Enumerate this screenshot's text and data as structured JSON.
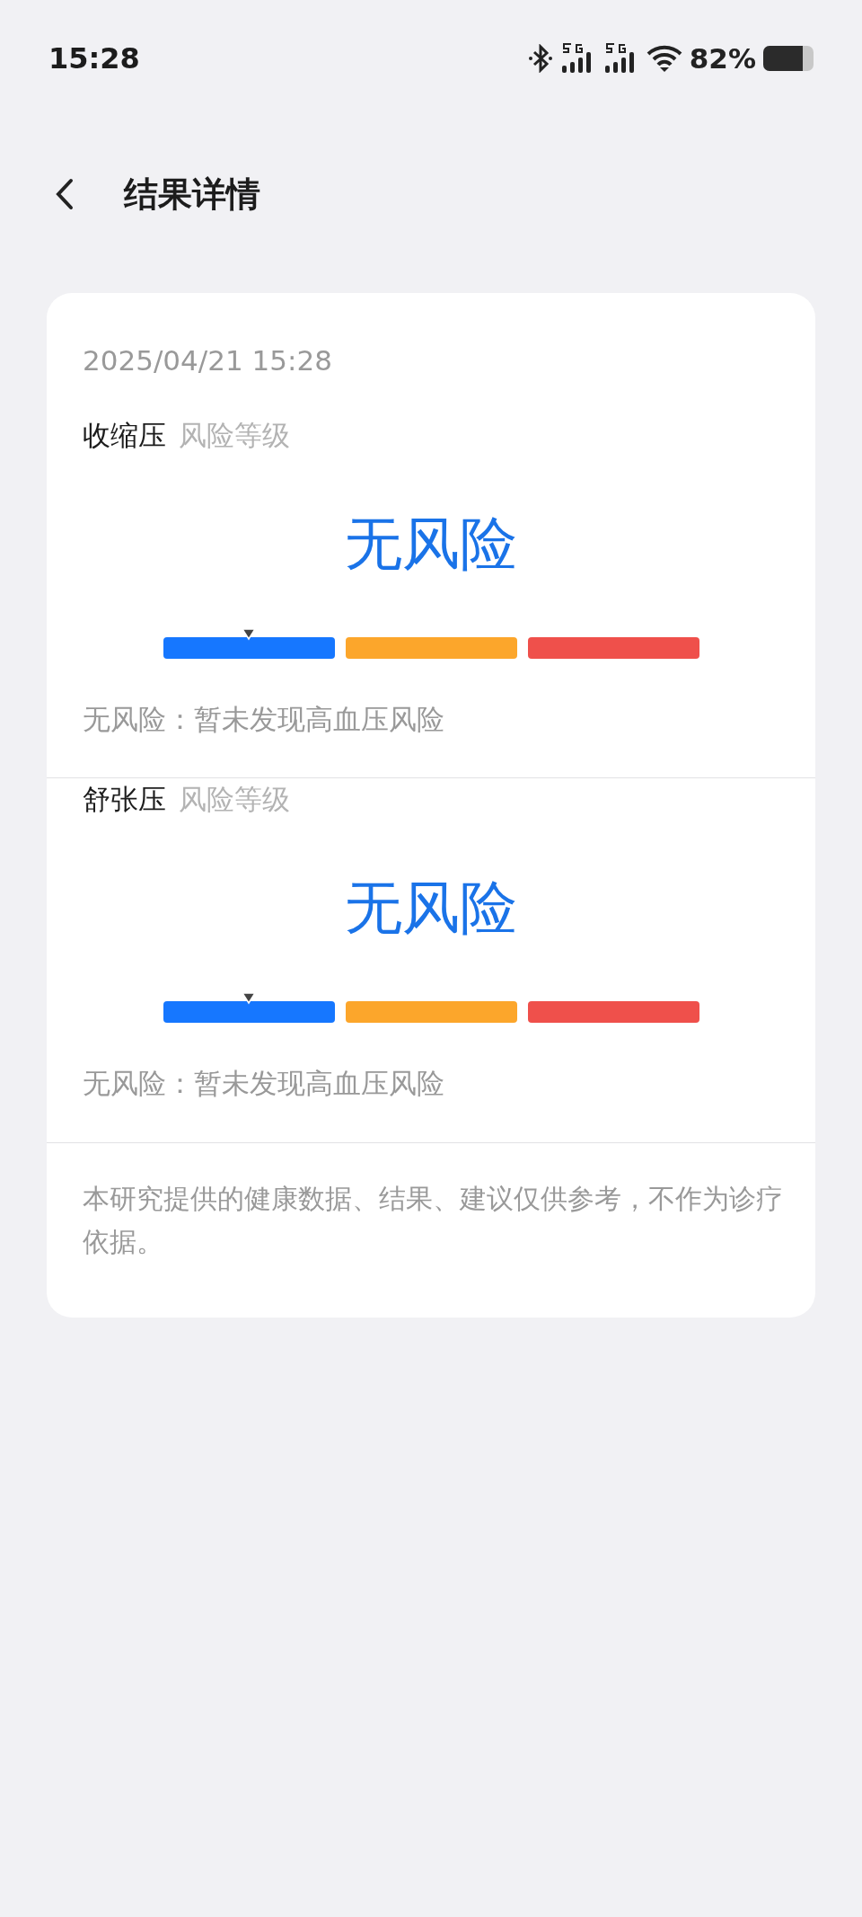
{
  "status_bar": {
    "time": "15:28",
    "battery": "82%"
  },
  "header": {
    "title": "结果详情"
  },
  "card": {
    "date": "2025/04/21 15:28",
    "sections": [
      {
        "label": "收缩压",
        "sublabel": "风险等级",
        "result": "无风险",
        "level": 0.16,
        "description": "无风险：暂未发现高血压风险"
      },
      {
        "label": "舒张压",
        "sublabel": "风险等级",
        "result": "无风险",
        "level": 0.16,
        "description": "无风险：暂未发现高血压风险"
      }
    ],
    "disclaimer": "本研究提供的健康数据、结果、建议仅供参考，不作为诊疗依据。"
  }
}
